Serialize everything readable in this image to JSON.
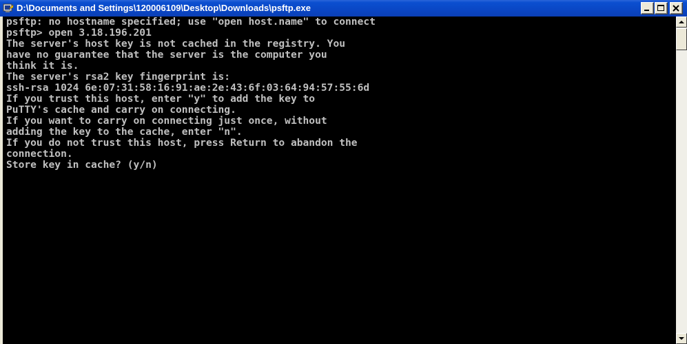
{
  "window": {
    "title": "D:\\Documents and Settings\\120006109\\Desktop\\Downloads\\psftp.exe",
    "icon": "console-app-icon",
    "controls": {
      "minimize": "minimize-icon",
      "maximize": "maximize-icon",
      "close": "close-icon"
    }
  },
  "console": {
    "lines": [
      "psftp: no hostname specified; use \"open host.name\" to connect",
      "psftp> open 3.18.196.201",
      "The server's host key is not cached in the registry. You",
      "have no guarantee that the server is the computer you",
      "think it is.",
      "The server's rsa2 key fingerprint is:",
      "ssh-rsa 1024 6e:07:31:58:16:91:ae:2e:43:6f:03:64:94:57:55:6d",
      "If you trust this host, enter \"y\" to add the key to",
      "PuTTY's cache and carry on connecting.",
      "If you want to carry on connecting just once, without",
      "adding the key to the cache, enter \"n\".",
      "If you do not trust this host, press Return to abandon the",
      "connection.",
      "Store key in cache? (y/n)"
    ]
  },
  "colors": {
    "console_background": "#000000",
    "console_text": "#C0C0C0",
    "titlebar": "#0A46C4",
    "titlebar_text": "#FFFFFF"
  }
}
